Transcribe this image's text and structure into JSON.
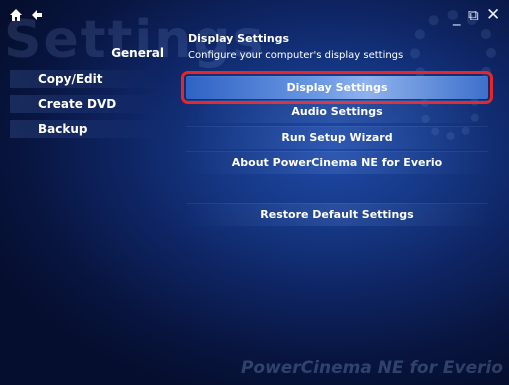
{
  "window": {
    "watermark_title": "Settings",
    "controls": {
      "minimize": "_",
      "restore": "⧉",
      "close": "✕"
    }
  },
  "icons": {
    "home": "home-icon",
    "back": "back-arrow-icon",
    "minimize": "minimize-icon",
    "restore": "restore-icon",
    "close": "close-icon"
  },
  "sidebar": {
    "heading": "General",
    "items": [
      {
        "label": "Copy/Edit"
      },
      {
        "label": "Create DVD"
      },
      {
        "label": "Backup"
      }
    ]
  },
  "panel": {
    "title": "Display Settings",
    "subtitle": "Configure your computer's display settings",
    "menu": [
      {
        "label": "Display Settings",
        "selected": true
      },
      {
        "label": "Audio Settings"
      },
      {
        "label": "Run Setup Wizard"
      },
      {
        "label": "About PowerCinema NE for Everio"
      },
      {
        "label": "Restore Default Settings"
      }
    ]
  },
  "brand": {
    "text": "PowerCinema NE for Everio"
  },
  "colors": {
    "highlight_outline": "#e8262a",
    "background": "#0e2462",
    "text": "#ffffff"
  }
}
